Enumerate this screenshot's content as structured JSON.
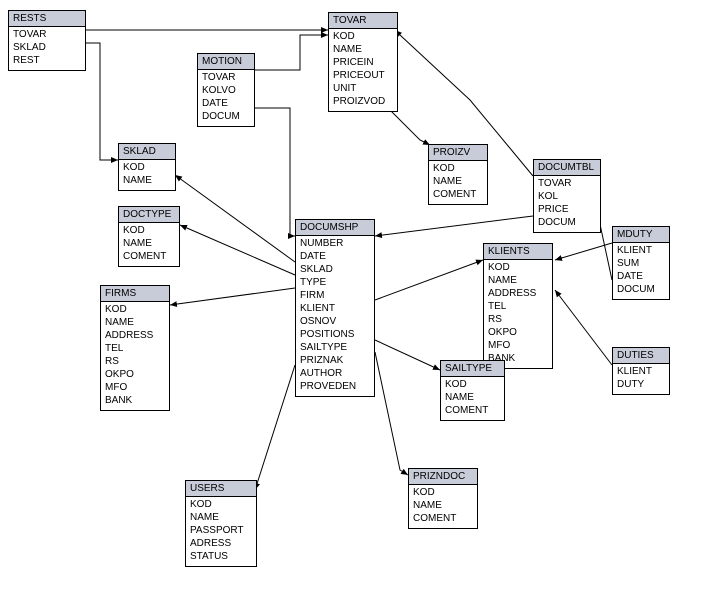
{
  "tables": {
    "rests": {
      "title": "RESTS",
      "fields": [
        "TOVAR",
        "SKLAD",
        "REST"
      ]
    },
    "tovar": {
      "title": "TOVAR",
      "fields": [
        "KOD",
        "NAME",
        "PRICEIN",
        "PRICEOUT",
        "UNIT",
        "PROIZVOD"
      ]
    },
    "motion": {
      "title": "MOTION",
      "fields": [
        "TOVAR",
        "KOLVO",
        "DATE",
        "DOCUM"
      ]
    },
    "sklad": {
      "title": "SKLAD",
      "fields": [
        "KOD",
        "NAME"
      ]
    },
    "proizv": {
      "title": "PROIZV",
      "fields": [
        "KOD",
        "NAME",
        "COMENT"
      ]
    },
    "documtbl": {
      "title": "DOCUMTBL",
      "fields": [
        "TOVAR",
        "KOL",
        "PRICE",
        "DOCUM"
      ]
    },
    "doctype": {
      "title": "DOCTYPE",
      "fields": [
        "KOD",
        "NAME",
        "COMENT"
      ]
    },
    "documshp": {
      "title": "DOCUMSHP",
      "fields": [
        "NUMBER",
        "DATE",
        "SKLAD",
        "TYPE",
        "FIRM",
        "KLIENT",
        "OSNOV",
        "POSITIONS",
        "SAILTYPE",
        "PRIZNAK",
        "AUTHOR",
        "PROVEDEN"
      ]
    },
    "klients": {
      "title": "KLIENTS",
      "fields": [
        "KOD",
        "NAME",
        "ADDRESS",
        "TEL",
        "RS",
        "OKPO",
        "MFO",
        "BANK"
      ]
    },
    "mduty": {
      "title": "MDUTY",
      "fields": [
        "KLIENT",
        "SUM",
        "DATE",
        "DOCUM"
      ]
    },
    "firms": {
      "title": "FIRMS",
      "fields": [
        "KOD",
        "NAME",
        "ADDRESS",
        "TEL",
        "RS",
        "OKPO",
        "MFO",
        "BANK"
      ]
    },
    "sailtype": {
      "title": "SAILTYPE",
      "fields": [
        "KOD",
        "NAME",
        "COMENT"
      ]
    },
    "duties": {
      "title": "DUTIES",
      "fields": [
        "KLIENT",
        "DUTY"
      ]
    },
    "users": {
      "title": "USERS",
      "fields": [
        "KOD",
        "NAME",
        "PASSPORT",
        "ADRESS",
        "STATUS"
      ]
    },
    "prizndoc": {
      "title": "PRIZNDOC",
      "fields": [
        "KOD",
        "NAME",
        "COMENT"
      ]
    }
  },
  "relations": [
    {
      "from": "rests.TOVAR",
      "to": "tovar.KOD"
    },
    {
      "from": "rests.SKLAD",
      "to": "sklad.KOD"
    },
    {
      "from": "motion.TOVAR",
      "to": "tovar.KOD"
    },
    {
      "from": "motion.DOCUM",
      "to": "documshp.NUMBER"
    },
    {
      "from": "tovar.PROIZVOD",
      "to": "proizv.KOD"
    },
    {
      "from": "documtbl.TOVAR",
      "to": "tovar.KOD"
    },
    {
      "from": "documtbl.DOCUM",
      "to": "documshp.NUMBER"
    },
    {
      "from": "documshp.SKLAD",
      "to": "sklad.KOD"
    },
    {
      "from": "documshp.TYPE",
      "to": "doctype.KOD"
    },
    {
      "from": "documshp.FIRM",
      "to": "firms.KOD"
    },
    {
      "from": "documshp.KLIENT",
      "to": "klients.KOD"
    },
    {
      "from": "documshp.SAILTYPE",
      "to": "sailtype.KOD"
    },
    {
      "from": "documshp.PRIZNAK",
      "to": "prizndoc.KOD"
    },
    {
      "from": "documshp.AUTHOR",
      "to": "users.KOD"
    },
    {
      "from": "mduty.KLIENT",
      "to": "klients.KOD"
    },
    {
      "from": "mduty.DOCUM",
      "to": "documshp.NUMBER"
    },
    {
      "from": "duties.KLIENT",
      "to": "klients.KOD"
    }
  ]
}
